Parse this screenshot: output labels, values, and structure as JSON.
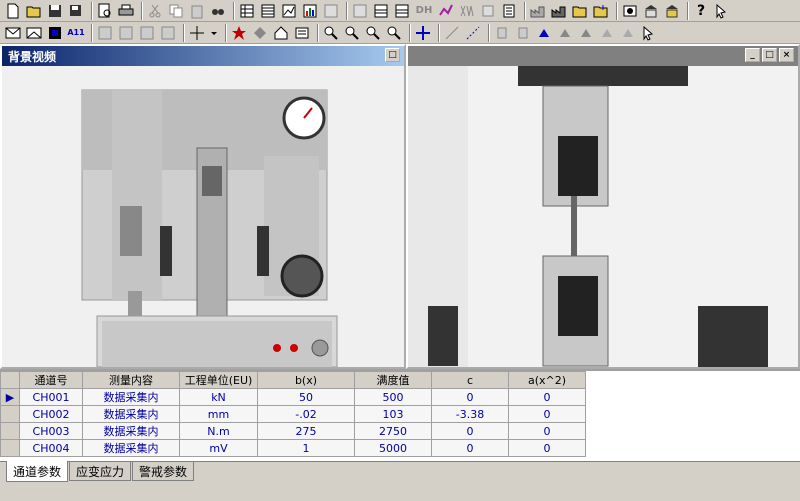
{
  "toolbar1": {
    "icons": [
      "new-icon",
      "open-icon",
      "save-icon",
      "save-all-icon",
      "print-preview-icon",
      "print-icon",
      "cut-icon",
      "copy-icon",
      "paste-icon",
      "find-icon",
      "table-icon",
      "grid-icon",
      "chart-icon",
      "bar-chart-icon",
      "image-icon",
      "report-icon",
      "list-icon",
      "text-dh-label",
      "wave-icon",
      "xw-icon",
      "export-icon",
      "calc-icon",
      "factory-icon",
      "building-icon",
      "folder-open-icon",
      "folder-save-icon",
      "tools-icon",
      "library-icon",
      "bank-icon",
      "help-icon",
      "pointer-help-icon"
    ],
    "dh_label": "DH"
  },
  "toolbar2": {
    "icons": [
      "envelope-icon",
      "mail-icon",
      "black-square-icon",
      "a11-icon",
      "align-left-icon",
      "align-center-icon",
      "align-right-icon",
      "align-justify-icon",
      "crosshair-icon",
      "dropdown-arrow-icon",
      "record-icon",
      "move-icon",
      "home-icon",
      "print2-icon",
      "zoom-in-icon",
      "zoom-out-icon",
      "zoom-fit-icon",
      "zoom-custom-icon",
      "pan-icon",
      "line-tool-icon",
      "dash-tool-icon",
      "clip1-icon",
      "clip2-icon",
      "fill-icon",
      "pointer2-icon",
      "arrow1-icon",
      "arrow2-icon",
      "arrow3-icon",
      "hand-cursor-icon"
    ],
    "a11_label": "A11"
  },
  "window1": {
    "title": "背景视频"
  },
  "grid": {
    "headers": [
      "通道号",
      "测量内容",
      "工程单位(EU)",
      "b(x)",
      "满度值",
      "c",
      "a(x^2)"
    ],
    "rows": [
      [
        "CH001",
        "数据采集内",
        "kN",
        "50",
        "500",
        "0",
        "0"
      ],
      [
        "CH002",
        "数据采集内",
        "mm",
        "-.02",
        "103",
        "-3.38",
        "0"
      ],
      [
        "CH003",
        "数据采集内",
        "N.m",
        "275",
        "2750",
        "0",
        "0"
      ],
      [
        "CH004",
        "数据采集内",
        "mV",
        "1",
        "5000",
        "0",
        "0"
      ]
    ]
  },
  "tabs": [
    "通道参数",
    "应变应力",
    "警戒参数"
  ],
  "colors": {
    "title_active": "#0a246a",
    "grid_text": "#0000a0"
  }
}
